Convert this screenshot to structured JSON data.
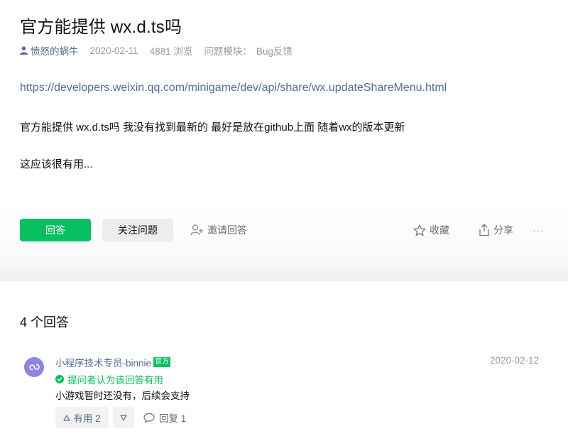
{
  "question": {
    "title": "官方能提供 wx.d.ts吗",
    "author": "愤怒的蜗牛",
    "date": "2020-02-11",
    "views": "4881 浏览",
    "module_label": "问题模块：",
    "module_value": "Bug反馈",
    "link": "https://developers.weixin.qq.com/minigame/dev/api/share/wx.updateShareMenu.html",
    "paragraphs": [
      "官方能提供 wx.d.ts吗 我没有找到最新的 最好是放在github上面 随着wx的版本更新",
      "这应该很有用..."
    ]
  },
  "actions": {
    "answer": "回答",
    "follow": "关注问题",
    "invite": "邀请回答",
    "favorite": "收藏",
    "share": "分享",
    "more": "···"
  },
  "answers": {
    "count_label": "4 个回答",
    "items": [
      {
        "author": "小程序技术专员-binnie",
        "badge": "官方",
        "date": "2020-02-12",
        "accepted_text": "提问者认为该回答有用",
        "body": "小游戏暂时还没有，后续会支持",
        "useful_label": "有用 2",
        "reply_label": "回复 1"
      }
    ]
  },
  "colors": {
    "brand_green": "#07c160",
    "link_blue": "#576b95",
    "avatar_purple": "#8c85e6"
  }
}
